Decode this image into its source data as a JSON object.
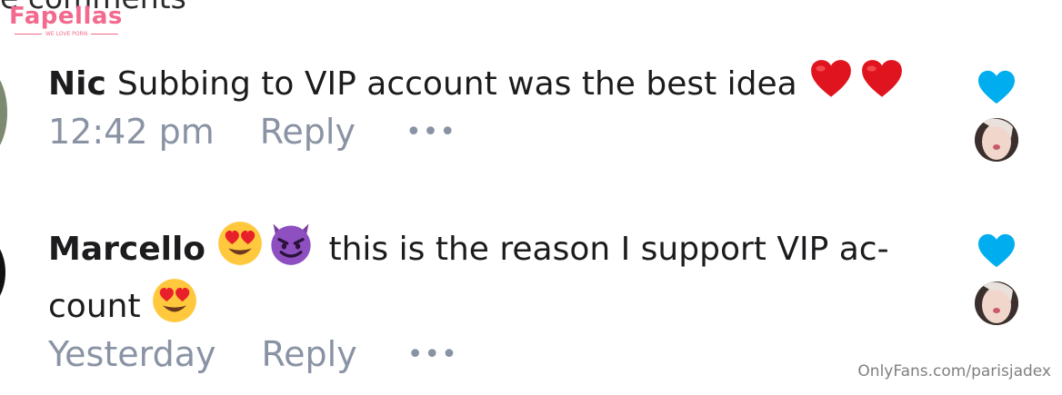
{
  "header": {
    "partial_text": "e comments"
  },
  "watermark": {
    "brand": "Fapellas",
    "tagline": "WE LOVE PORN"
  },
  "comments": [
    {
      "author": "Nic",
      "text": "Subbing to VIP account was the best idea",
      "time": "12:42 pm",
      "reply": "Reply",
      "more": "•••"
    },
    {
      "author": "Marcello",
      "text_part1": "this is the reason I support VIP ac-",
      "text_part2": "count",
      "time": "Yesterday",
      "reply": "Reply",
      "more": "•••"
    }
  ],
  "credit": "OnlyFans.com/parisjadex",
  "colors": {
    "like": "#00AEEF",
    "meta": "#8A93A4",
    "brand": "#F26A8D",
    "heart_red": "#E0141E"
  }
}
